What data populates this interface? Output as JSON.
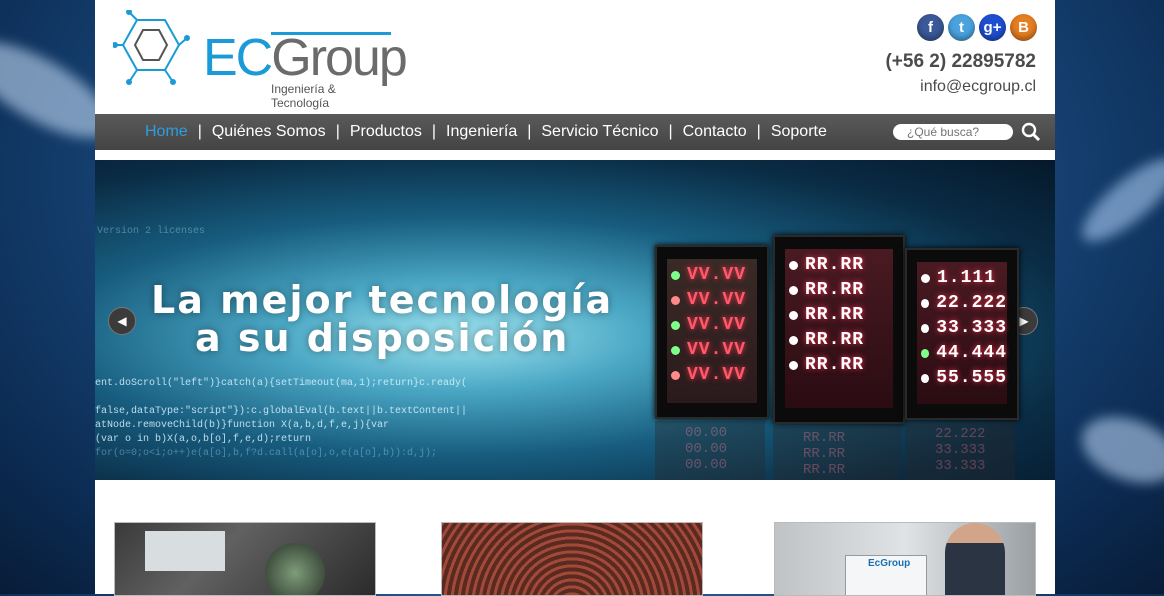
{
  "brand": {
    "logo_primary": "EC",
    "logo_secondary": "Group",
    "tagline": "Ingeniería & Tecnología"
  },
  "social": [
    {
      "name": "facebook-icon",
      "glyph": "f",
      "color": "#3b5998"
    },
    {
      "name": "twitter-icon",
      "glyph": "t",
      "color": "#4aa3df"
    },
    {
      "name": "google-plus-icon",
      "glyph": "g+",
      "color": "#1f4fd1"
    },
    {
      "name": "blogger-icon",
      "glyph": "B",
      "color": "#e67e22"
    }
  ],
  "contact": {
    "phone": "(+56 2) 22895782",
    "email": "info@ecgroup.cl"
  },
  "nav": {
    "items": [
      "Home",
      "Quiénes Somos",
      "Productos",
      "Ingeniería",
      "Servicio Técnico",
      "Contacto",
      "Soporte"
    ],
    "separator": "|",
    "active_color": "#2a9ee0"
  },
  "search": {
    "placeholder": "¿Qué busca?"
  },
  "banner": {
    "headline_line1": "La mejor tecnología",
    "headline_line2": "a su disposición",
    "prev_arrow": "◀",
    "next_arrow": "▶",
    "code_lines": [
      "Version 2 licenses",
      "ent.doScroll(\"left\")}catch(a){setTimeout(ma,1);return}c.ready(",
      "false,dataType:\"script\"}):c.globalEval(b.text||b.textContent||",
      "atNode.removeChild(b)}function X(a,b,d,f,e,j){var",
      "(var o in b)X(a,o,b[o],f,e,d);return",
      "for(o=0;o<i;o++)e(a[o],b,f?d.call(a[o],o,e(a[o],b)):d,j);"
    ],
    "meters": [
      {
        "rows": [
          "VV.VV",
          "VV.VV",
          "VV.VV",
          "VV.VV",
          "VV.VV"
        ],
        "text_color": "#ff5a6a",
        "dot_colors": [
          "#7dff8a",
          "#ff8a8a",
          "#7dff8a",
          "#7dff8a",
          "#ff8a8a"
        ]
      },
      {
        "rows": [
          "RR.RR",
          "RR.RR",
          "RR.RR",
          "RR.RR",
          "RR.RR"
        ],
        "text_color": "#ffffff",
        "dot_colors": [
          "#ffffff",
          "#ffffff",
          "#ffffff",
          "#ffffff",
          "#ffffff"
        ]
      },
      {
        "rows": [
          "1.111",
          "22.222",
          "33.333",
          "44.444",
          "55.555"
        ],
        "text_color": "#ffffff",
        "dot_colors": [
          "#ffffff",
          "#ffffff",
          "#ffffff",
          "#7dff8a",
          "#ffffff"
        ]
      }
    ],
    "reflection_rows": [
      [
        "00.00",
        "00.00",
        "00.00"
      ],
      [
        "RR.RR",
        "RR.RR",
        "RR.RR"
      ],
      [
        "22.222",
        "33.333",
        "33.333"
      ]
    ]
  },
  "thumbnails": [
    {
      "name": "thumbnail-scanner"
    },
    {
      "name": "thumbnail-led-display"
    },
    {
      "name": "thumbnail-business-man",
      "caption": "EcGroup"
    }
  ]
}
